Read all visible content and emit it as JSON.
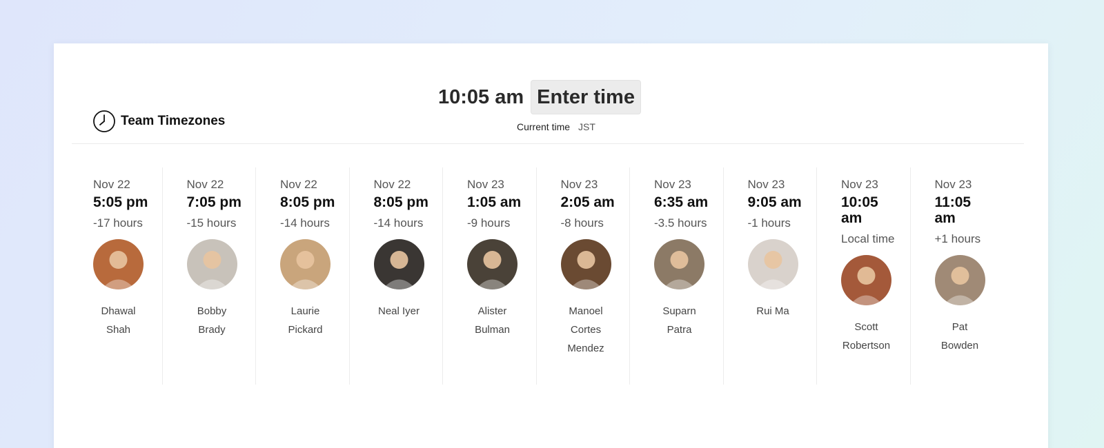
{
  "app": {
    "title": "Team Timezones",
    "current_time": "10:05 am",
    "enter_time_label": "Enter time",
    "current_time_label": "Current time",
    "timezone": "JST"
  },
  "members": [
    {
      "date": "Nov 22",
      "time": "5:05 pm",
      "offset": "-17 hours",
      "name": "Dhawal Shah",
      "avatar_color": "#b86a3c"
    },
    {
      "date": "Nov 22",
      "time": "7:05 pm",
      "offset": "-15 hours",
      "name": "Bobby Brady",
      "avatar_color": "#c8c2ba"
    },
    {
      "date": "Nov 22",
      "time": "8:05 pm",
      "offset": "-14 hours",
      "name": "Laurie Pickard",
      "avatar_color": "#c9a57c"
    },
    {
      "date": "Nov 22",
      "time": "8:05 pm",
      "offset": "-14 hours",
      "name": "Neal Iyer",
      "avatar_color": "#3a3633"
    },
    {
      "date": "Nov 23",
      "time": "1:05 am",
      "offset": "-9 hours",
      "name": "Alister Bulman",
      "avatar_color": "#4a4238"
    },
    {
      "date": "Nov 23",
      "time": "2:05 am",
      "offset": "-8 hours",
      "name": "Manoel Cortes Mendez",
      "avatar_color": "#6a4a32"
    },
    {
      "date": "Nov 23",
      "time": "6:35 am",
      "offset": "-3.5 hours",
      "name": "Suparn Patra",
      "avatar_color": "#8c7a66"
    },
    {
      "date": "Nov 23",
      "time": "9:05 am",
      "offset": "-1 hours",
      "name": "Rui Ma",
      "avatar_color": "#d9d2cc"
    },
    {
      "date": "Nov 23",
      "time": "10:05 am",
      "offset": "Local time",
      "name": "Scott Robertson",
      "avatar_color": "#a4593a"
    },
    {
      "date": "Nov 23",
      "time": "11:05 am",
      "offset": "+1 hours",
      "name": "Pat Bowden",
      "avatar_color": "#a08a76"
    }
  ]
}
